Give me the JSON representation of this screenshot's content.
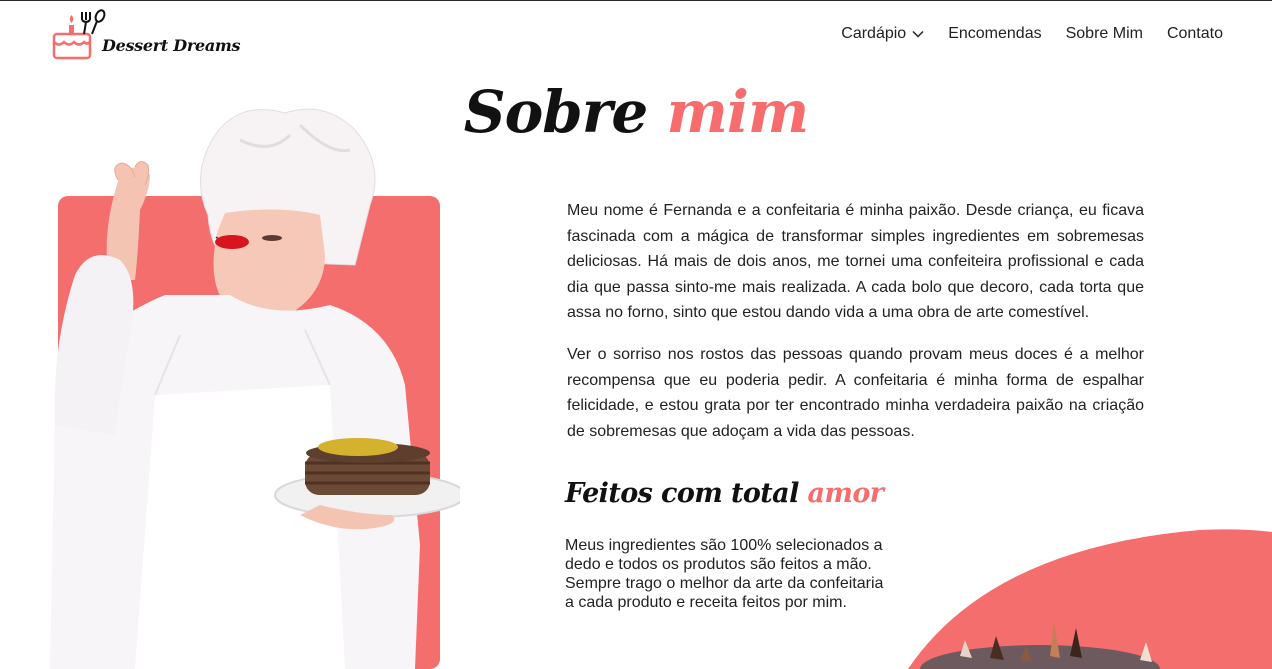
{
  "brand": {
    "name": "Dessert Dreams",
    "logo_icon": "cake-fork-spoon-icon"
  },
  "nav": {
    "items": [
      {
        "label": "Cardápio",
        "icon": "chevron-down-icon"
      },
      {
        "label": "Encomendas"
      },
      {
        "label": "Sobre Mim"
      },
      {
        "label": "Contato"
      }
    ]
  },
  "hero": {
    "title_main": "Sobre ",
    "title_accent": "mim"
  },
  "about": {
    "paragraph_1": "Meu nome é Fernanda e a confeitaria é minha paixão. Desde criança, eu ficava fascinada com a mágica de transformar simples ingredientes em sobremesas deliciosas. Há mais de dois anos, me tornei uma confeiteira profissional e cada dia que passa sinto-me mais realizada. A cada bolo que decoro, cada torta que assa no forno, sinto que estou dando vida a uma obra de arte comestível.",
    "paragraph_2": "Ver o sorriso nos rostos das pessoas quando provam meus doces é a melhor recompensa que eu poderia pedir. A confeitaria é minha forma de espalhar felicidade, e estou grata por ter encontrado minha verdadeira paixão na criação de sobremesas que adoçam a vida das pessoas."
  },
  "feature": {
    "title_main": "Feitos com total ",
    "title_accent": "amor",
    "text": "Meus ingredientes são 100% selecionados a dedo e todos os produtos são feitos a mão. Sempre trago o melhor da arte da confeitaria a cada produto e receita feitos por mim."
  },
  "colors": {
    "accent": "#f76d6d",
    "card": "#f46e6e",
    "text": "#222222"
  }
}
